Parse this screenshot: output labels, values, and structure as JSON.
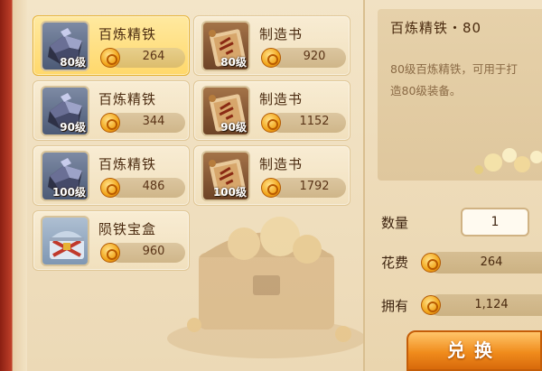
{
  "items": [
    {
      "name": "百炼精铁",
      "level": "80级",
      "price": "264",
      "type": "iron",
      "selected": true
    },
    {
      "name": "制造书",
      "level": "80级",
      "price": "920",
      "type": "book"
    },
    {
      "name": "百炼精铁",
      "level": "90级",
      "price": "344",
      "type": "iron"
    },
    {
      "name": "制造书",
      "level": "90级",
      "price": "1152",
      "type": "book"
    },
    {
      "name": "百炼精铁",
      "level": "100级",
      "price": "486",
      "type": "iron"
    },
    {
      "name": "制造书",
      "level": "100级",
      "price": "1792",
      "type": "book"
    },
    {
      "name": "陨铁宝盒",
      "level": "",
      "price": "960",
      "type": "box"
    }
  ],
  "detail": {
    "title": "百炼精铁・80",
    "description": "80级百炼精铁，可用于打\n造80级装备。"
  },
  "purchase": {
    "quantity_label": "数量",
    "quantity_value": "1",
    "cost_label": "花费",
    "cost_value": "264",
    "owned_label": "拥有",
    "owned_value": "1,124",
    "exchange_label": "兑换"
  },
  "colors": {
    "selected_item": "#ffd86b",
    "exchange_button": "#f08c1c",
    "frame_red": "#c2412a"
  },
  "icons": {
    "currency": "gold-coin-icon",
    "iron": "iron-ingot-icon",
    "book": "manufacture-scroll-icon",
    "box": "treasure-chest-icon"
  }
}
